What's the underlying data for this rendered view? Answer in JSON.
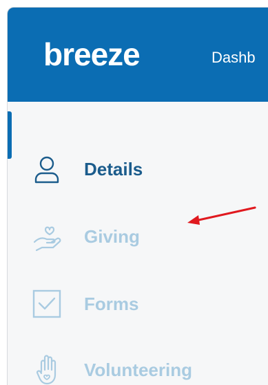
{
  "header": {
    "logo_text": "breeze",
    "nav_item": "Dashb"
  },
  "sidebar": {
    "items": [
      {
        "label": "Details",
        "icon": "person-icon",
        "active": true
      },
      {
        "label": "Giving",
        "icon": "hand-heart-icon",
        "active": false
      },
      {
        "label": "Forms",
        "icon": "checkbox-icon",
        "active": false
      },
      {
        "label": "Volunteering",
        "icon": "raised-hand-icon",
        "active": false
      }
    ]
  },
  "annotation": {
    "icon": "red-arrow-icon",
    "color": "#e0191f"
  },
  "colors": {
    "brand": "#0b6db3",
    "active_text": "#1b5c8c",
    "inactive_text": "#a9cbe1",
    "sidebar_bg": "#f6f7f8"
  }
}
